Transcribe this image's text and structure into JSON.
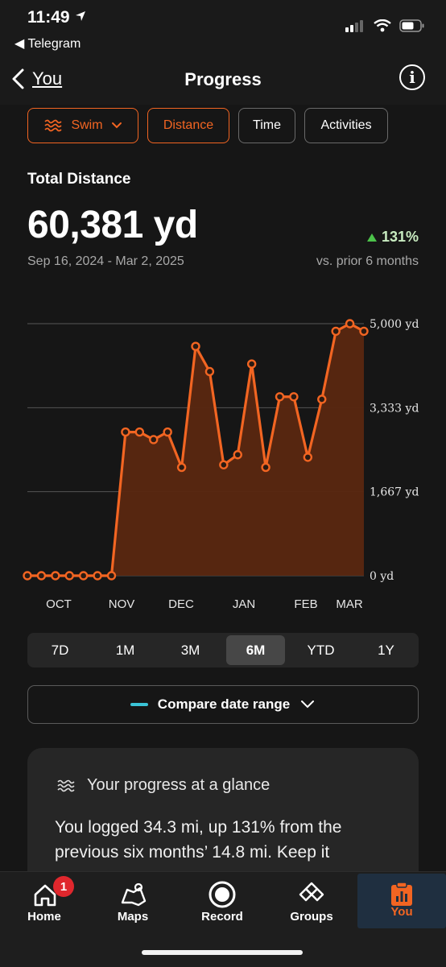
{
  "status": {
    "time": "11:49",
    "back_app": "◀ Telegram"
  },
  "header": {
    "back_label": "You",
    "title": "Progress",
    "info_icon": "i"
  },
  "filters": {
    "sport": "Swim",
    "metric": "Distance",
    "time": "Time",
    "activities": "Activities"
  },
  "stats": {
    "label": "Total Distance",
    "value": "60,381 yd",
    "range": "Sep 16, 2024 - Mar 2, 2025",
    "change": "131%",
    "change_sub": "vs. prior 6 months"
  },
  "colors": {
    "accent": "#f26522",
    "positive": "#4cc34a",
    "compare": "#3ac3d6",
    "badge": "#e0272d"
  },
  "chart_data": {
    "type": "area",
    "y_ticks": [
      "5,000 yd",
      "3,333 yd",
      "1,667 yd",
      "0 yd"
    ],
    "ylim": [
      0,
      5000
    ],
    "x_labels": [
      "OCT",
      "NOV",
      "DEC",
      "JAN",
      "FEB",
      "MAR"
    ],
    "grid": true,
    "values": [
      0,
      0,
      0,
      0,
      0,
      0,
      0,
      2850,
      2850,
      2700,
      2850,
      2150,
      4550,
      4050,
      2200,
      2400,
      4200,
      2150,
      3550,
      3550,
      2350,
      3500,
      4850,
      5000,
      4850
    ]
  },
  "range_tabs": [
    "7D",
    "1M",
    "3M",
    "6M",
    "YTD",
    "1Y"
  ],
  "range_selected": "6M",
  "compare": {
    "label": "Compare date range"
  },
  "glance": {
    "title": "Your progress at a glance",
    "text": "You logged 34.3 mi, up 131% from the previous six months’ 14.8 mi. Keep it"
  },
  "nav": {
    "items": [
      "Home",
      "Maps",
      "Record",
      "Groups",
      "You"
    ],
    "badge": "1",
    "selected": "You"
  }
}
